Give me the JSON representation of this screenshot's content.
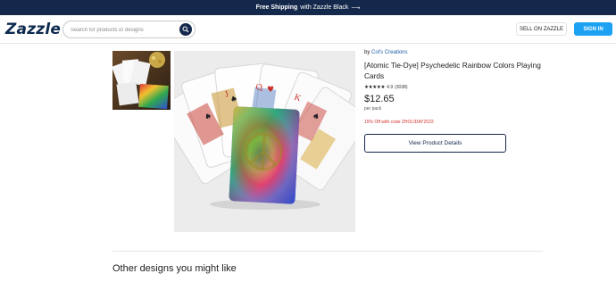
{
  "promo_banner": {
    "bold": "Free Shipping",
    "rest": "with Zazzle Black",
    "arrow": "⟶"
  },
  "header": {
    "logo": "Zazzle",
    "search_placeholder": "Search for products or designs",
    "search_icon": "search-icon",
    "sell_label": "SELL ON ZAZZLE",
    "signin_label": "SIGN IN"
  },
  "product": {
    "by_prefix": "by",
    "creator": "Col's Creations",
    "title": "[Atomic Tie-Dye] Psychedelic Rainbow Colors Playing Cards",
    "stars": "★★★★★",
    "rating": "4.9",
    "reviews": "(3038)",
    "price": "$12.65",
    "per": "per pack",
    "promo": "15% Off with code ZHOLIDAY2022",
    "view_button": "View Product Details"
  },
  "other_designs": "Other designs you might like",
  "colors": {
    "navy": "#14284b",
    "blue": "#1da1f2",
    "link": "#1b5ba6",
    "promo_red": "#d0312d"
  }
}
